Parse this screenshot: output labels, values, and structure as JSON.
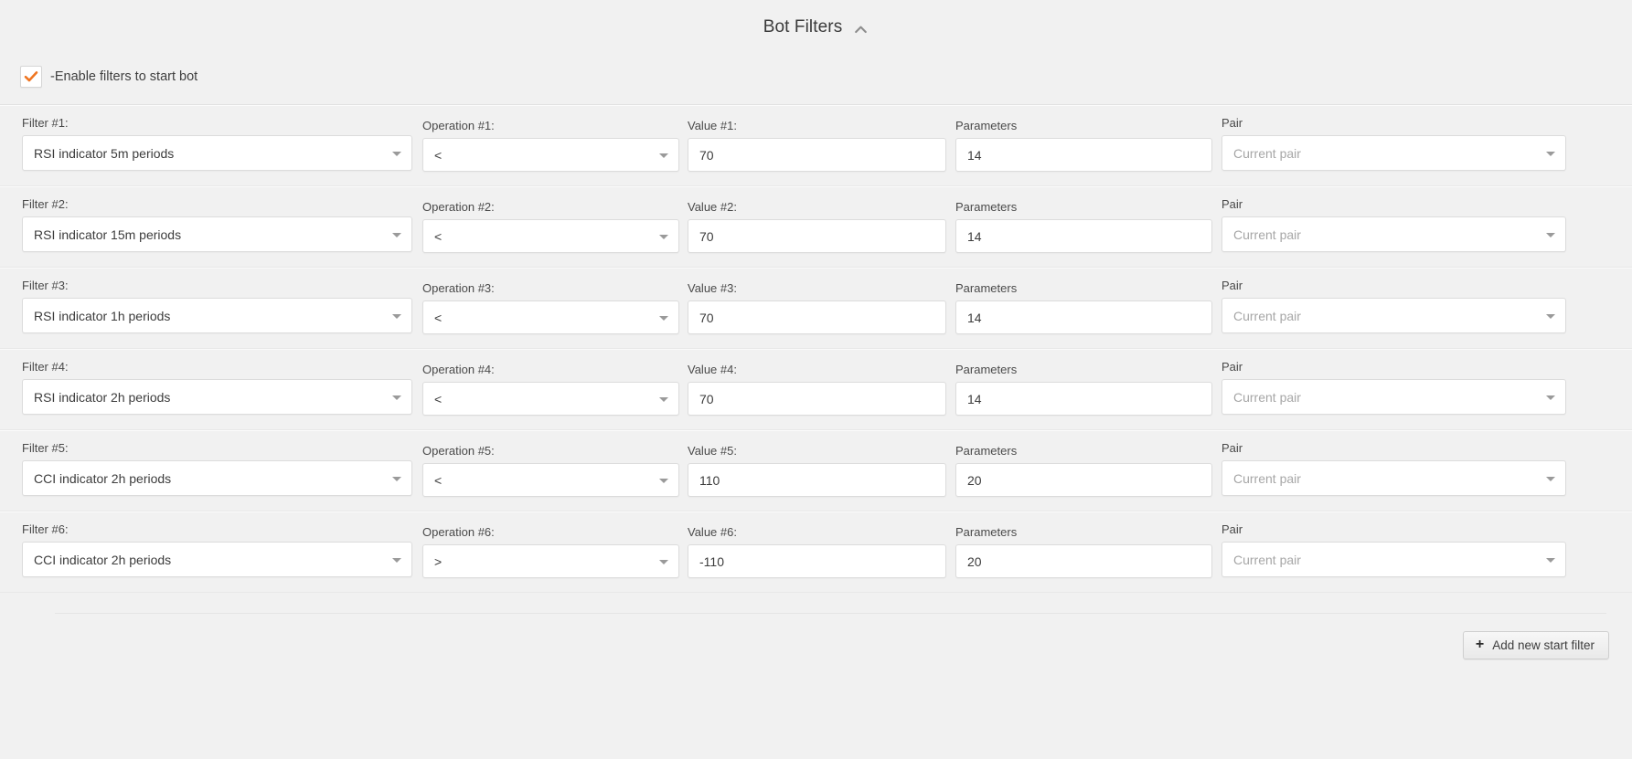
{
  "header": {
    "title": "Bot Filters",
    "collapse_icon": "chevron-up-icon"
  },
  "enable": {
    "label": "-Enable filters to start bot",
    "checked": true,
    "check_color": "#ef7622"
  },
  "columns": {
    "filter": "Filter",
    "operation": "Operation",
    "value": "Value",
    "parameters": "Parameters",
    "pair": "Pair"
  },
  "pair_placeholder": "Current pair",
  "rows": [
    {
      "filter_label": "Filter #1:",
      "filter_value": "RSI indicator 5m periods",
      "operation_label": "Operation #1:",
      "operation_value": "<",
      "value_label": "Value #1:",
      "value_value": "70",
      "parameters_label": "Parameters",
      "parameters_value": "14",
      "pair_label": "Pair",
      "pair_value": "Current pair"
    },
    {
      "filter_label": "Filter #2:",
      "filter_value": "RSI indicator 15m periods",
      "operation_label": "Operation #2:",
      "operation_value": "<",
      "value_label": "Value #2:",
      "value_value": "70",
      "parameters_label": "Parameters",
      "parameters_value": "14",
      "pair_label": "Pair",
      "pair_value": "Current pair"
    },
    {
      "filter_label": "Filter #3:",
      "filter_value": "RSI indicator 1h periods",
      "operation_label": "Operation #3:",
      "operation_value": "<",
      "value_label": "Value #3:",
      "value_value": "70",
      "parameters_label": "Parameters",
      "parameters_value": "14",
      "pair_label": "Pair",
      "pair_value": "Current pair"
    },
    {
      "filter_label": "Filter #4:",
      "filter_value": "RSI indicator 2h periods",
      "operation_label": "Operation #4:",
      "operation_value": "<",
      "value_label": "Value #4:",
      "value_value": "70",
      "parameters_label": "Parameters",
      "parameters_value": "14",
      "pair_label": "Pair",
      "pair_value": "Current pair"
    },
    {
      "filter_label": "Filter #5:",
      "filter_value": "CCI indicator 2h periods",
      "operation_label": "Operation #5:",
      "operation_value": "<",
      "value_label": "Value #5:",
      "value_value": "110",
      "parameters_label": "Parameters",
      "parameters_value": "20",
      "pair_label": "Pair",
      "pair_value": "Current pair"
    },
    {
      "filter_label": "Filter #6:",
      "filter_value": "CCI indicator 2h periods",
      "operation_label": "Operation #6:",
      "operation_value": ">",
      "value_label": "Value #6:",
      "value_value": "-110",
      "parameters_label": "Parameters",
      "parameters_value": "20",
      "pair_label": "Pair",
      "pair_value": "Current pair"
    }
  ],
  "footer": {
    "add_label": "Add new start filter",
    "add_icon": "plus-icon"
  }
}
